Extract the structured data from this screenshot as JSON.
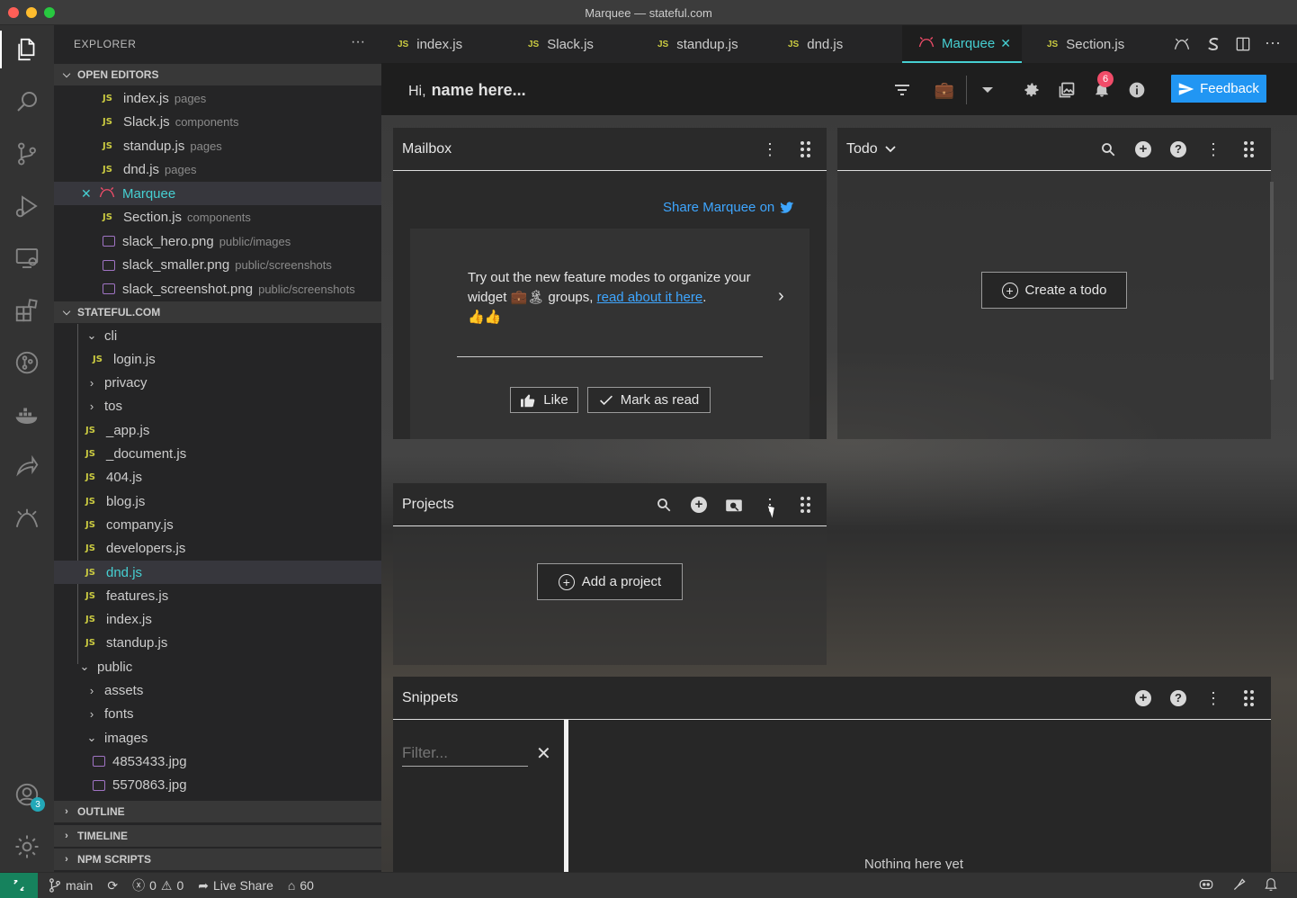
{
  "window": {
    "title": "Marquee — stateful.com"
  },
  "activity": {
    "account_badge": "3"
  },
  "explorer": {
    "title": "EXPLORER",
    "more": "···",
    "open_editors_label": "OPEN EDITORS",
    "open_editors": [
      {
        "name": "index.js",
        "desc": "pages",
        "type": "js"
      },
      {
        "name": "Slack.js",
        "desc": "components",
        "type": "js"
      },
      {
        "name": "standup.js",
        "desc": "pages",
        "type": "js"
      },
      {
        "name": "dnd.js",
        "desc": "pages",
        "type": "js"
      },
      {
        "name": "Marquee",
        "desc": "",
        "type": "marquee"
      },
      {
        "name": "Section.js",
        "desc": "components",
        "type": "js"
      },
      {
        "name": "slack_hero.png",
        "desc": "public/images",
        "type": "img"
      },
      {
        "name": "slack_smaller.png",
        "desc": "public/screenshots",
        "type": "img"
      },
      {
        "name": "slack_screenshot.png",
        "desc": "public/screenshots",
        "type": "img"
      }
    ],
    "project_label": "STATEFUL.COM",
    "tree": [
      {
        "name": "cli",
        "kind": "folder-open",
        "depth": 1
      },
      {
        "name": "login.js",
        "kind": "js",
        "depth": 2
      },
      {
        "name": "privacy",
        "kind": "folder",
        "depth": 1
      },
      {
        "name": "tos",
        "kind": "folder",
        "depth": 1
      },
      {
        "name": "_app.js",
        "kind": "js",
        "depth": 1
      },
      {
        "name": "_document.js",
        "kind": "js",
        "depth": 1
      },
      {
        "name": "404.js",
        "kind": "js",
        "depth": 1
      },
      {
        "name": "blog.js",
        "kind": "js",
        "depth": 1
      },
      {
        "name": "company.js",
        "kind": "js",
        "depth": 1
      },
      {
        "name": "developers.js",
        "kind": "js",
        "depth": 1
      },
      {
        "name": "dnd.js",
        "kind": "js",
        "depth": 1,
        "selected": true
      },
      {
        "name": "features.js",
        "kind": "js",
        "depth": 1
      },
      {
        "name": "index.js",
        "kind": "js",
        "depth": 1
      },
      {
        "name": "standup.js",
        "kind": "js",
        "depth": 1
      },
      {
        "name": "public",
        "kind": "folder-open",
        "depth": 0
      },
      {
        "name": "assets",
        "kind": "folder",
        "depth": 1
      },
      {
        "name": "fonts",
        "kind": "folder",
        "depth": 1
      },
      {
        "name": "images",
        "kind": "folder-open",
        "depth": 1
      },
      {
        "name": "4853433.jpg",
        "kind": "img",
        "depth": 2
      },
      {
        "name": "5570863.jpg",
        "kind": "img",
        "depth": 2
      }
    ],
    "outline_label": "OUTLINE",
    "timeline_label": "TIMELINE",
    "npm_label": "NPM SCRIPTS"
  },
  "tabs": [
    {
      "label": "index.js",
      "type": "js"
    },
    {
      "label": "Slack.js",
      "type": "js"
    },
    {
      "label": "standup.js",
      "type": "js"
    },
    {
      "label": "dnd.js",
      "type": "js"
    },
    {
      "label": "Marquee",
      "type": "marquee",
      "active": true
    },
    {
      "label": "Section.js",
      "type": "js"
    }
  ],
  "marquee": {
    "greeting": "Hi,",
    "name": "name here...",
    "notification_count": "6",
    "feedback_label": "Feedback",
    "mailbox": {
      "title": "Mailbox",
      "share_text": "Share Marquee on",
      "message_prefix": "Try out the new feature modes to organize your widget 💼🏝 groups,",
      "message_link": "read about it here",
      "message_suffix": ".",
      "message_emoji": "👍👍",
      "like_label": "Like",
      "mark_read_label": "Mark as read"
    },
    "todo": {
      "title": "Todo",
      "create_label": "Create a todo"
    },
    "projects": {
      "title": "Projects",
      "add_label": "Add a project"
    },
    "snippets": {
      "title": "Snippets",
      "filter_placeholder": "Filter...",
      "empty_text": "Nothing here yet"
    }
  },
  "statusbar": {
    "branch": "main",
    "errors": "0",
    "warnings": "0",
    "live_share": "Live Share",
    "count": "60"
  }
}
